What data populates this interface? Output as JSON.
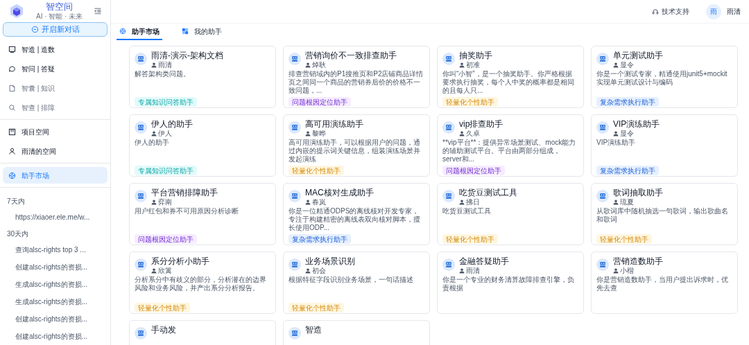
{
  "sidebar": {
    "brand": {
      "title": "智空间",
      "subtitle": "AI · 智能 · 未来"
    },
    "new_chat": "开启新对话",
    "menu_groups": [
      [
        {
          "label": "智造 | 造数",
          "disabled": false,
          "selected": false
        },
        {
          "label": "智问 | 答疑",
          "disabled": false,
          "selected": false
        },
        {
          "label": "智囊 | 知识",
          "disabled": true,
          "selected": false
        },
        {
          "label": "智查 | 排障",
          "disabled": true,
          "selected": false
        }
      ],
      [
        {
          "label": "项目空间",
          "disabled": false,
          "selected": false
        },
        {
          "label": "雨清的空间",
          "disabled": false,
          "selected": false
        }
      ],
      [
        {
          "label": "助手市场",
          "disabled": false,
          "selected": true
        }
      ]
    ],
    "history": [
      {
        "heading": "7天内",
        "items": [
          "https://xiaoer.ele.me/w..."
        ]
      },
      {
        "heading": "30天内",
        "items": [
          "查询alsc-rights top 3 ...",
          "创建alsc-rights的资损...",
          "生成alsc-rights的资损...",
          "生成alsc-rights的资损...",
          "创建alsc-rights的资损...",
          "创建alsc-rights的资损..."
        ]
      }
    ]
  },
  "header": {
    "support": "技术支持",
    "user": {
      "avatar": "雨",
      "name": "雨清"
    }
  },
  "tabs": [
    {
      "label": "助手市场",
      "selected": true
    },
    {
      "label": "我的助手",
      "selected": false
    }
  ],
  "cards": [
    {
      "title": "雨清-演示-架构文档",
      "author": "雨清",
      "description": "解答架构类问题。",
      "tag": {
        "label": "专属知识问答助手",
        "color": "#e3fafa"
      }
    },
    {
      "title": "营销询价不一致排查助手",
      "author": "焯耿",
      "description": "排查营销域内的P1搜推页和P2店铺商品详情页之间同一个商品的营销券后价的价格不一致问题，...",
      "tag": {
        "label": "问题根因定位助手",
        "color": "#f6edff"
      }
    },
    {
      "title": "抽奖助手",
      "author": "初准",
      "description": "你叫“小智”，是一个抽奖助手。你严格根据要求执行抽奖，每个人中奖的概率都是相同的且每人只...",
      "tag": {
        "label": "轻量化个性助手",
        "color": "#fff6e0"
      }
    },
    {
      "title": "单元测试助手",
      "author": "显令",
      "description": "你是一个测试专家，精通使用junit5+mockit实现单元测试设计与编码",
      "tag": {
        "label": "复杂需求执行助手",
        "color": "#e6f0ff"
      }
    },
    {
      "title": "伊人的助手",
      "author": "伊人",
      "description": "伊人的助手",
      "tag": {
        "label": "专属知识问答助手",
        "color": "#e3fafa"
      }
    },
    {
      "title": "高可用演练助手",
      "author": "黎晔",
      "description": "高可用演练助手，可以根据用户的问题，通过内嵌的提示词关键信息，组装演练场景并发起演练",
      "tag": {
        "label": "轻量化个性助手",
        "color": "#fff6e0"
      }
    },
    {
      "title": "vip排查助手",
      "author": "久卓",
      "description": "**vip平台**：提供异常场景测试、mock能力的辅助测试平台。平台由两部分组成，server和...",
      "tag": {
        "label": "问题根因定位助手",
        "color": "#f6edff"
      }
    },
    {
      "title": "VIP演练助手",
      "author": "显令",
      "description": "VIP演练助手",
      "tag": {
        "label": "复杂需求执行助手",
        "color": "#e6f0ff"
      }
    },
    {
      "title": "平台营销排障助手",
      "author": "弈南",
      "description": "用户红包和券不可用原因分析诊断",
      "tag": {
        "label": "问题根因定位助手",
        "color": "#f6edff"
      }
    },
    {
      "title": "MAC核对生成助手",
      "author": "春岚",
      "description": "你是一位精通ODPS的离线核对开发专家，专注于构建精密的离线表双向核对脚本，擅长使用ODP...",
      "tag": {
        "label": "复杂需求执行助手",
        "color": "#e6f0ff"
      }
    },
    {
      "title": "吃货豆测试工具",
      "author": "拂日",
      "description": "吃货豆测试工具",
      "tag": {
        "label": "轻量化个性助手",
        "color": "#fff6e0"
      }
    },
    {
      "title": "歌词抽取助手",
      "author": "琉夏",
      "description": "从歌词库中随机抽选一句歌词，输出歌曲名和歌词",
      "tag": {
        "label": "轻量化个性助手",
        "color": "#fff6e0"
      }
    },
    {
      "title": "系分分析小助手",
      "author": "欣篱",
      "description": "分析系分中有歧义的部分，分析潜在的边界风险和业务风险，并产出系分分析报告。",
      "tag": {
        "label": "轻量化个性助手",
        "color": "#fff6e0"
      }
    },
    {
      "title": "业务场景识别",
      "author": "初会",
      "description": "根据特征字段识别业务场景，一句话描述",
      "tag": {
        "label": "轻量化个性助手",
        "color": "#fff6e0"
      }
    },
    {
      "title": "金融答疑助手",
      "author": "雨清",
      "description": "你是一个专业的财务清算故障排查引擎，负责根据"
    },
    {
      "title": "营销造数助手",
      "author": "小楷",
      "description": "你是营销造数助手，当用户提出诉求时，优先去查"
    },
    {
      "title": "手动发"
    },
    {
      "title": "智造"
    }
  ]
}
